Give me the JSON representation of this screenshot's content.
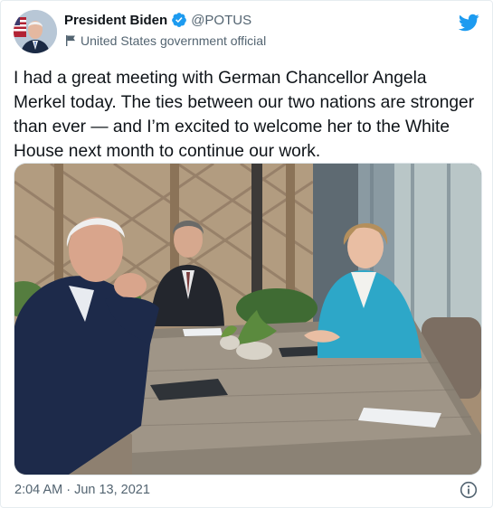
{
  "author": {
    "display_name": "President Biden",
    "handle": "@POTUS",
    "affiliation": "United States government official",
    "avatar_icon": "presidential-portrait-avatar",
    "verified_icon": "verified-badge-icon"
  },
  "tweet": {
    "text": "I had a great meeting with German Chancellor Angela Merkel today. The ties between our two nations are stronger than ever — and I’m excited to welcome her to the White House next month to continue our work.",
    "timestamp": "2:04 AM · Jun 13, 2021"
  },
  "photo": {
    "subject": "photo-leaders-meeting-at-patio-table"
  },
  "icons": {
    "platform": "twitter-bird-icon",
    "info": "info-icon",
    "flag": "government-flag-icon"
  },
  "colors": {
    "brand": "#1d9bf0",
    "secondary_text": "#536471",
    "primary_text": "#0f1419"
  }
}
